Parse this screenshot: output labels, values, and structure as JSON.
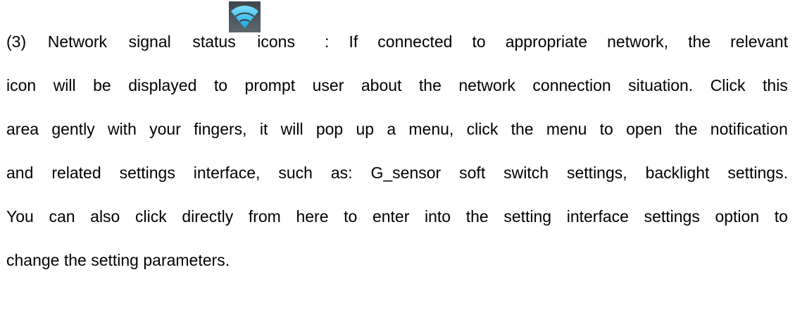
{
  "document": {
    "lines": [
      {
        "before_icon": "(3) Network signal status icons",
        "after_icon": ": If connected to appropriate network, the relevant"
      },
      {
        "text": "icon will be displayed to prompt user about the network connection situation. Click this"
      },
      {
        "text": "area gently with your fingers, it will pop up a menu, click the menu to open the notification"
      },
      {
        "text": "and related settings interface, such as: G_sensor soft switch settings, backlight settings."
      },
      {
        "text": "You can also click directly from here to enter into the setting interface settings option to"
      },
      {
        "text": "change the setting parameters."
      }
    ],
    "icon": {
      "name": "wifi-signal-icon",
      "arc_color": "#2bb8f0",
      "background_color": "#4c545a"
    }
  }
}
